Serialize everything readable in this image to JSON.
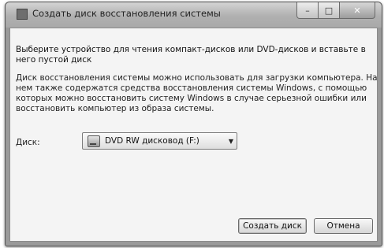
{
  "window": {
    "title": "Создать диск восстановления системы",
    "caption_buttons": {
      "minimize": "–",
      "maximize": "□",
      "close": "✕"
    }
  },
  "dialog": {
    "instruction": "Выберите устройство для чтения компакт-дисков или DVD-дисков и вставьте в него пустой диск",
    "description": "Диск восстановления системы можно использовать для загрузки компьютера. На нем также содержатся средства восстановления системы Windows, с помощью которых можно восстановить систему Windows в случае серьезной ошибки или восстановить компьютер из образа системы.",
    "drive_label": "Диск:",
    "drive_select": {
      "value": "DVD RW дисковод (F:)",
      "icon": "optical-drive-icon"
    },
    "buttons": {
      "create": "Создать диск",
      "cancel": "Отмена"
    }
  }
}
